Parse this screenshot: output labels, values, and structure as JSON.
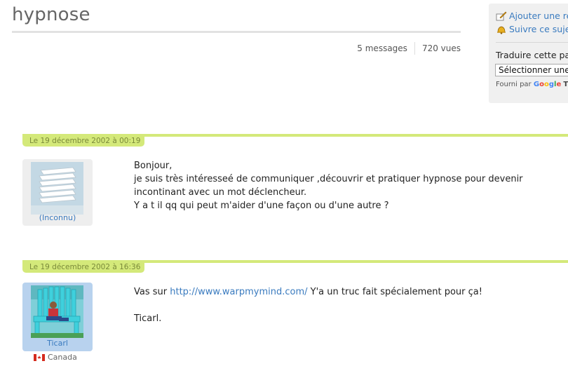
{
  "topic": {
    "title": "hypnose",
    "messages": "5 messages",
    "views": "720 vues"
  },
  "sidebar": {
    "add_reply": "Ajouter une ré",
    "follow": "Suivre ce sujet",
    "translate_label": "Traduire cette pag",
    "translate_select": "Sélectionner une",
    "powered_by": "Fourni par",
    "google": [
      "G",
      "o",
      "o",
      "g",
      "l",
      "e"
    ],
    "translate_word": "Tr"
  },
  "posts": [
    {
      "date": "Le 19 décembre 2002 à 00:19",
      "author": "(Inconnu)",
      "lines": [
        "Bonjour,",
        "je suis très intéresseé de communiquer ,découvrir et pratiquer hypnose pour devenir incontinant avec un mot déclencheur.",
        "Y a t il qq qui peut m'aider d'une façon ou d'une autre ?"
      ]
    },
    {
      "date": "Le 19 décembre 2002 à 16:36",
      "author": "Ticarl",
      "country": "Canada",
      "link": "http://www.warpmymind.com/",
      "text_before": "Vas sur ",
      "text_after": " Y'a un truc fait spécialement pour ça!",
      "signoff": "Ticarl."
    }
  ],
  "colors": {
    "accent_green": "#d4e97a",
    "link_blue": "#3a7bbf"
  }
}
